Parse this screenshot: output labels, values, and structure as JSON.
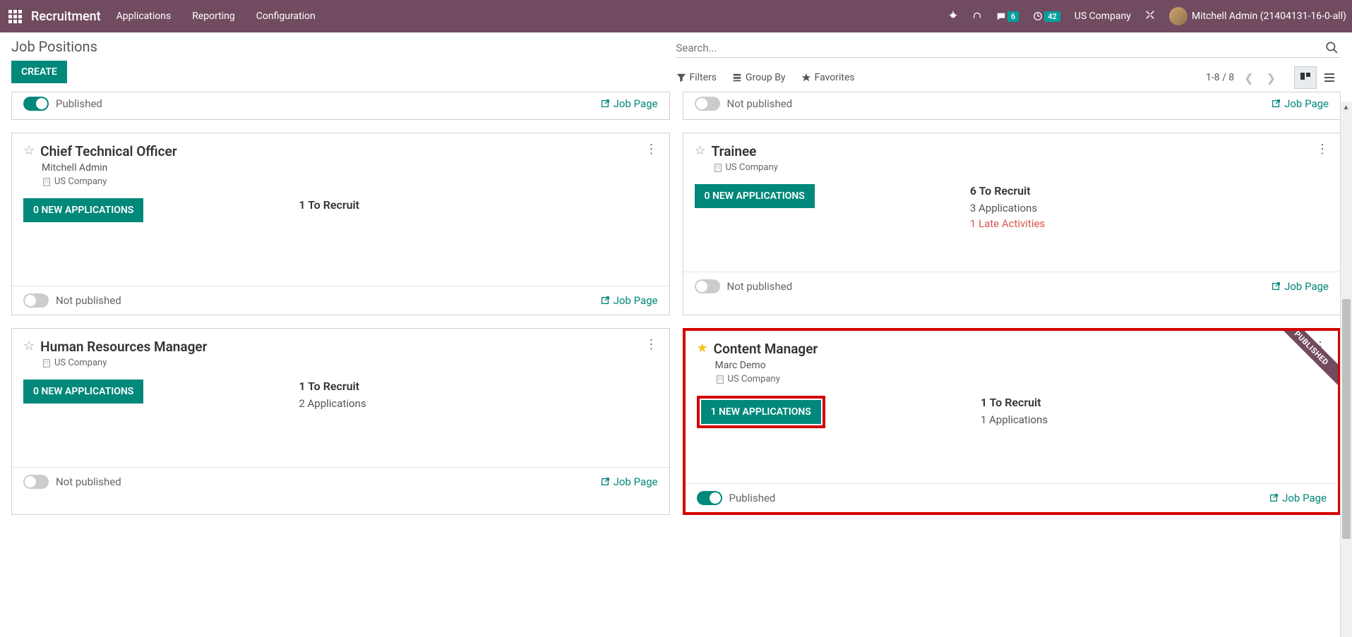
{
  "header": {
    "brand": "Recruitment",
    "nav": [
      "Applications",
      "Reporting",
      "Configuration"
    ],
    "msg_badge": "6",
    "clock_badge": "42",
    "company": "US Company",
    "user": "Mitchell Admin (21404131-16-0-all)"
  },
  "page": {
    "title": "Job Positions",
    "create": "CREATE",
    "search_placeholder": "Search...",
    "filters": "Filters",
    "groupby": "Group By",
    "favorites": "Favorites",
    "pager": "1-8 / 8"
  },
  "partials": {
    "left": {
      "published": true,
      "pub_label": "Published",
      "job_page": "Job Page"
    },
    "right": {
      "published": false,
      "pub_label": "Not published",
      "job_page": "Job Page"
    }
  },
  "cards": [
    {
      "title": "Chief Technical Officer",
      "subtitle": "Mitchell Admin",
      "company": "US Company",
      "app_btn": "0 NEW APPLICATIONS",
      "recruit": "1 To Recruit",
      "applications": "",
      "late": "",
      "published": false,
      "pub_label": "Not published",
      "job_page": "Job Page",
      "starred": false,
      "highlighted": false,
      "app_highlighted": false,
      "ribbon": ""
    },
    {
      "title": "Trainee",
      "subtitle": "",
      "company": "US Company",
      "app_btn": "0 NEW APPLICATIONS",
      "recruit": "6 To Recruit",
      "applications": "3 Applications",
      "late": "1 Late Activities",
      "published": false,
      "pub_label": "Not published",
      "job_page": "Job Page",
      "starred": false,
      "highlighted": false,
      "app_highlighted": false,
      "ribbon": ""
    },
    {
      "title": "Human Resources Manager",
      "subtitle": "",
      "company": "US Company",
      "app_btn": "0 NEW APPLICATIONS",
      "recruit": "1 To Recruit",
      "applications": "2 Applications",
      "late": "",
      "published": false,
      "pub_label": "Not published",
      "job_page": "Job Page",
      "starred": false,
      "highlighted": false,
      "app_highlighted": false,
      "ribbon": ""
    },
    {
      "title": "Content Manager",
      "subtitle": "Marc Demo",
      "company": "US Company",
      "app_btn": "1 NEW APPLICATIONS",
      "recruit": "1 To Recruit",
      "applications": "1 Applications",
      "late": "",
      "published": true,
      "pub_label": "Published",
      "job_page": "Job Page",
      "starred": true,
      "highlighted": true,
      "app_highlighted": true,
      "ribbon": "PUBLISHED"
    }
  ]
}
